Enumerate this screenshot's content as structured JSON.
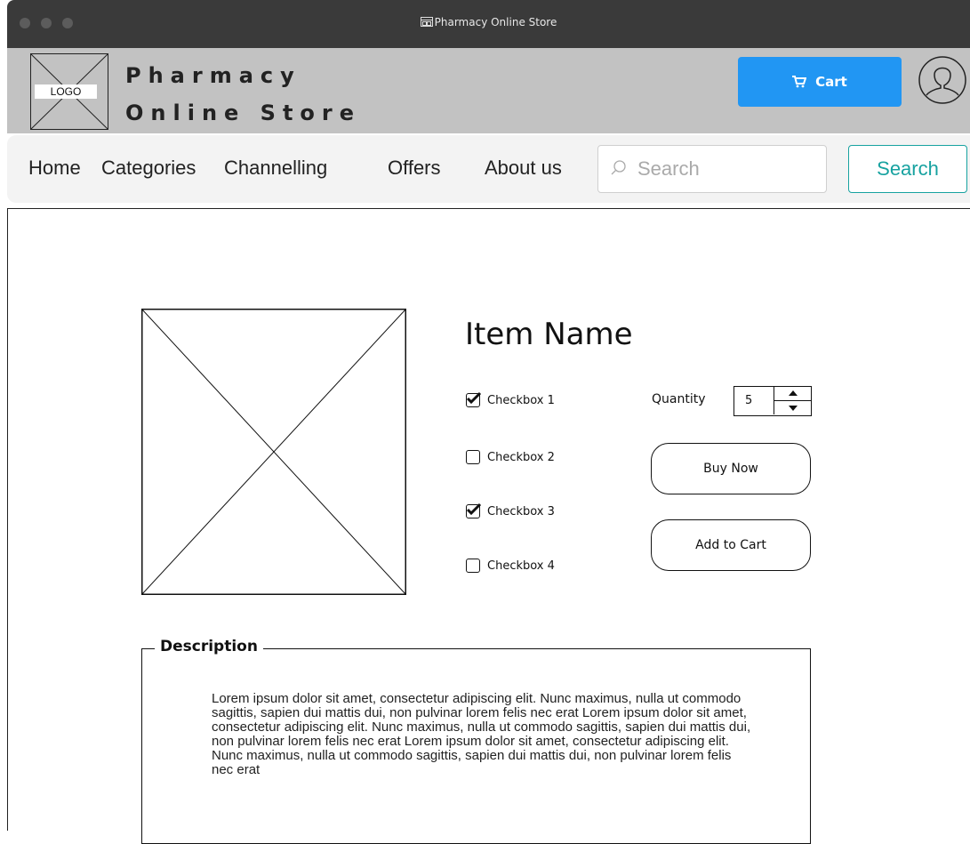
{
  "window": {
    "title": "Pharmacy Online Store"
  },
  "header": {
    "logo_text": "LOGO",
    "brand_line1": "Pharmacy",
    "brand_line2": "Online Store",
    "cart_label": "Cart"
  },
  "nav": {
    "items": [
      "Home",
      "Categories",
      "Channelling",
      "Offers",
      "About us"
    ],
    "search_placeholder": "Search",
    "search_button": "Search"
  },
  "product": {
    "name": "Item Name",
    "checkboxes": [
      {
        "label": "Checkbox 1",
        "checked": true
      },
      {
        "label": "Checkbox 2",
        "checked": false
      },
      {
        "label": "Checkbox 3",
        "checked": true
      },
      {
        "label": "Checkbox 4",
        "checked": false
      }
    ],
    "quantity_label": "Quantity",
    "quantity_value": "5",
    "buy_now": "Buy Now",
    "add_to_cart": "Add to Cart"
  },
  "description": {
    "legend": "Description",
    "text": "Lorem ipsum dolor sit amet, consectetur adipiscing elit. Nunc maximus, nulla ut commodo sagittis, sapien dui mattis dui, non pulvinar lorem felis nec erat Lorem ipsum dolor sit amet, consectetur adipiscing elit. Nunc maximus, nulla ut commodo sagittis, sapien dui mattis dui, non pulvinar lorem felis nec erat Lorem ipsum dolor sit amet, consectetur adipiscing elit. Nunc maximus, nulla ut commodo sagittis, sapien dui mattis dui, non pulvinar lorem felis nec erat"
  },
  "colors": {
    "accent": "#2196f3",
    "search_accent": "#17a2a0",
    "header_bg": "#c2c2c2",
    "titlebar_bg": "#3a3a3a"
  },
  "icons": {
    "cart": "cart-icon",
    "avatar": "user-avatar-icon",
    "search": "search-icon"
  }
}
